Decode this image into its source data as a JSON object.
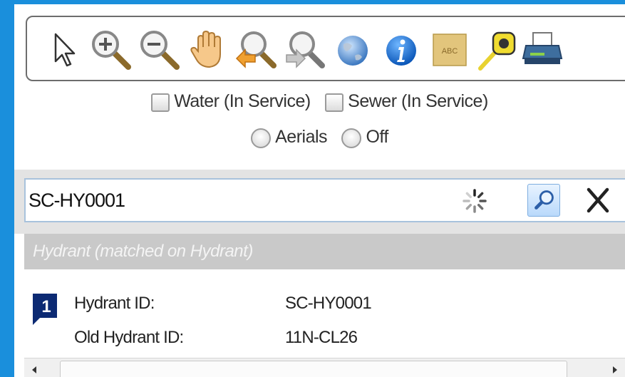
{
  "toolbar": {
    "tools": [
      {
        "icon": "pointer-icon"
      },
      {
        "icon": "zoom-in-icon"
      },
      {
        "icon": "zoom-out-icon"
      },
      {
        "icon": "pan-hand-icon"
      },
      {
        "icon": "zoom-previous-icon"
      },
      {
        "icon": "zoom-next-icon"
      },
      {
        "icon": "full-extent-globe-icon"
      },
      {
        "icon": "identify-info-icon"
      },
      {
        "icon": "label-abc-icon"
      },
      {
        "icon": "measure-tape-icon"
      },
      {
        "icon": "print-icon"
      }
    ],
    "abc_text": "ABC"
  },
  "layers": {
    "water_label": "Water (In Service)",
    "sewer_label": "Sewer (In Service)",
    "aerials_label": "Aerials",
    "off_label": "Off"
  },
  "search": {
    "value": "SC-HY0001"
  },
  "results": {
    "header": "Hydrant (matched on Hydrant)",
    "marker_number": "1",
    "fields": [
      {
        "label": "Hydrant ID:",
        "value": "SC-HY0001"
      },
      {
        "label": "Old Hydrant ID:",
        "value": "11N-CL26"
      }
    ]
  },
  "colors": {
    "frame_blue": "#1a8fdc",
    "header_gray": "#c9c9c9",
    "marker_navy": "#0c2a73"
  }
}
